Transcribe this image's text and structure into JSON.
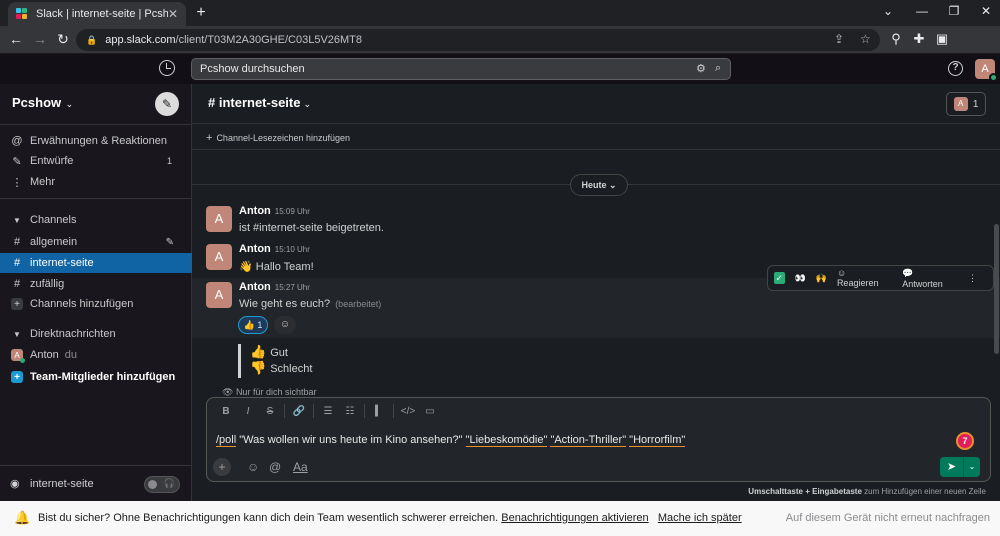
{
  "browser": {
    "tab_title": "Slack | internet-seite | Pcshow",
    "tab_close": "✕",
    "new_tab": "+",
    "url_host": "app.slack.com",
    "url_path": "/client/T03M2A30GHE/C03L5V26MT8",
    "profile_initial": "A"
  },
  "topbar": {
    "search_placeholder": "Pcshow durchsuchen",
    "user_initial": "A"
  },
  "sidebar": {
    "workspace": "Pcshow",
    "nav": [
      {
        "label": "Erwähnungen & Reaktionen",
        "count": ""
      },
      {
        "label": "Entwürfe",
        "count": "1"
      },
      {
        "label": "Mehr",
        "count": ""
      }
    ],
    "channels_header": "Channels",
    "channels": [
      "allgemein",
      "internet-seite",
      "zufällig"
    ],
    "add_channels": "Channels hinzufügen",
    "dm_header": "Direktnachrichten",
    "dm_user": "Anton",
    "dm_you": "du",
    "add_team": "Team-Mitglieder hinzufügen",
    "huddle_channel": "internet-seite"
  },
  "channel": {
    "name": "internet-seite",
    "member_count": "1",
    "bookmark": "Channel-Lesezeichen hinzufügen",
    "day": "Heute"
  },
  "messages": [
    {
      "author": "Anton",
      "initial": "A",
      "time": "15:09 Uhr",
      "text": "ist #internet-seite beigetreten.",
      "edited": ""
    },
    {
      "author": "Anton",
      "initial": "A",
      "time": "15:10 Uhr",
      "text": "👋 Hallo Team!",
      "edited": ""
    },
    {
      "author": "Anton",
      "initial": "A",
      "time": "15:27 Uhr",
      "text": "Wie geht es euch?",
      "edited": "(bearbeitet)"
    }
  ],
  "reaction": {
    "emoji": "👍",
    "count": "1"
  },
  "hover_actions": {
    "react": "Reagieren",
    "reply": "Antworten"
  },
  "poll": {
    "options": [
      {
        "emoji": "👍",
        "label": "Gut"
      },
      {
        "emoji": "👎",
        "label": "Schlecht"
      }
    ],
    "visibility": "Nur für dich sichtbar"
  },
  "composer": {
    "command": "/poll",
    "question": "\"Was wollen wir uns heute im Kino ansehen?\"",
    "option1": "\"Liebeskomödie\"",
    "option2": "\"Action-Thriller\"",
    "option3": "\"Horrorfilm\"",
    "text_icon": "Aa",
    "grammarly_count": "7",
    "hint_bold": "Umschalttaste + Eingabetaste",
    "hint_rest": "zum Hinzufügen einer neuen Zeile"
  },
  "banner": {
    "text": "Bist du sicher? Ohne Benachrichtigungen kann dich dein Team wesentlich schwerer erreichen.",
    "enable_link": "Benachrichtigungen aktivieren",
    "later_link": "Mache ich später",
    "dismiss": "Auf diesem Gerät nicht erneut nachfragen"
  },
  "colors": {
    "accent": "#1164a3",
    "send": "#007a5a",
    "online": "#2bac76",
    "avatar": "#c08779"
  }
}
